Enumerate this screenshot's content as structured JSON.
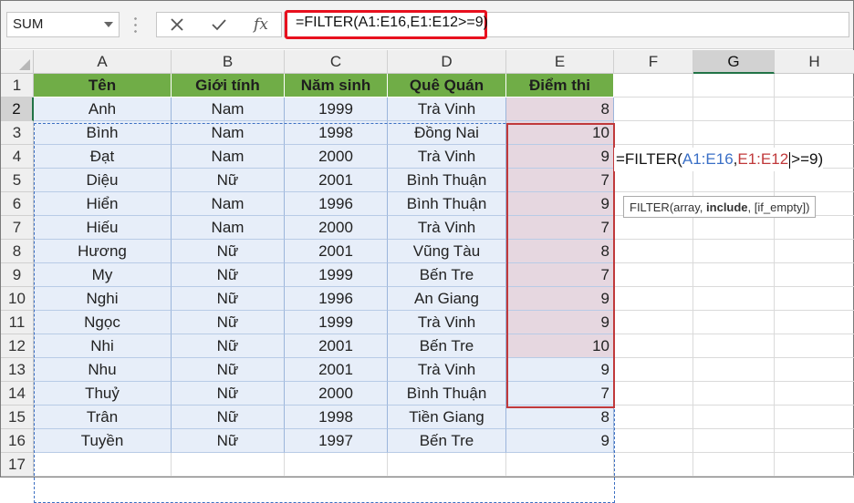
{
  "name_box": {
    "value": "SUM",
    "icon": "chevron-down-icon"
  },
  "formula_bar": {
    "cancel_icon": "close-icon",
    "enter_icon": "check-icon",
    "fx_label": "fx",
    "formula": "=FILTER(A1:E16,E1:E12>=9)",
    "highlight_color": "#e8101e"
  },
  "columns": [
    "A",
    "B",
    "C",
    "D",
    "E",
    "F",
    "G",
    "H"
  ],
  "rows": [
    "1",
    "2",
    "3",
    "4",
    "5",
    "6",
    "7",
    "8",
    "9",
    "10",
    "11",
    "12",
    "13",
    "14",
    "15",
    "16",
    "17"
  ],
  "table": {
    "header": [
      "Tên",
      "Giới tính",
      "Năm sinh",
      "Quê Quán",
      "Điểm thi"
    ],
    "body": [
      [
        "Anh",
        "Nam",
        "1999",
        "Trà Vinh",
        "8"
      ],
      [
        "Bình",
        "Nam",
        "1998",
        "Đồng Nai",
        "10"
      ],
      [
        "Đạt",
        "Nam",
        "2000",
        "Trà Vinh",
        "9"
      ],
      [
        "Diệu",
        "Nữ",
        "2001",
        "Bình Thuận",
        "7"
      ],
      [
        "Hiển",
        "Nam",
        "1996",
        "Bình Thuận",
        "9"
      ],
      [
        "Hiếu",
        "Nam",
        "2000",
        "Trà Vinh",
        "7"
      ],
      [
        "Hương",
        "Nữ",
        "2001",
        "Vũng Tàu",
        "8"
      ],
      [
        "My",
        "Nữ",
        "1999",
        "Bến Tre",
        "7"
      ],
      [
        "Nghi",
        "Nữ",
        "1996",
        "An Giang",
        "9"
      ],
      [
        "Ngọc",
        "Nữ",
        "1999",
        "Trà Vinh",
        "9"
      ],
      [
        "Nhi",
        "Nữ",
        "2001",
        "Bến Tre",
        "10"
      ],
      [
        "Nhu",
        "Nữ",
        "2001",
        "Trà Vinh",
        "9"
      ],
      [
        "Thuỷ",
        "Nữ",
        "2000",
        "Bình Thuận",
        "7"
      ],
      [
        "Trân",
        "Nữ",
        "1998",
        "Tiền Giang",
        "8"
      ],
      [
        "Tuyền",
        "Nữ",
        "1997",
        "Bến Tre",
        "9"
      ]
    ]
  },
  "editing_cell": {
    "address": "G2",
    "prefix": "=FILTER(",
    "ref1": "A1:E16",
    "comma": ",",
    "ref2": "E1:E12",
    "suffix": ">=9)"
  },
  "tooltip": {
    "open": "FILTER(array, ",
    "bold": "include",
    "rest": ", [if_empty])"
  },
  "colors": {
    "header_fill": "#70ad47",
    "table_fill": "#e7eef9",
    "criteria_fill": "#e6d7e0",
    "ref1_color": "#3a6fc6",
    "ref2_color": "#c0393b"
  }
}
